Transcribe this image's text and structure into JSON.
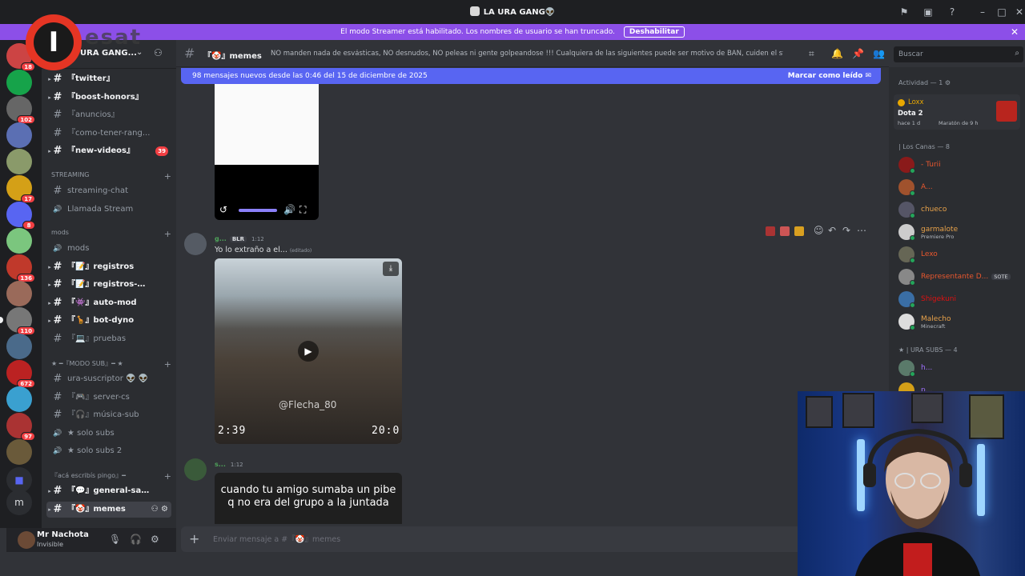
{
  "window": {
    "title": "LA URA GANG👽"
  },
  "banner": {
    "text": "El modo Streamer está habilitado. Los nombres de usuario se han truncado.",
    "button": "Deshabilitar"
  },
  "brand": {
    "text": "esat"
  },
  "rail": {
    "servers": [
      {
        "badge": "18",
        "color": "#c44"
      },
      {
        "badge": "",
        "color": "#16a34a"
      },
      {
        "badge": "102",
        "color": "#666"
      },
      {
        "badge": "",
        "color": "#5b6fb3"
      },
      {
        "badge": "",
        "color": "#8a9a6a"
      },
      {
        "badge": "17",
        "color": "#d4a017"
      },
      {
        "badge": "8",
        "color": "#5865f2"
      },
      {
        "badge": "",
        "color": "#7bc67e"
      },
      {
        "badge": "136",
        "color": "#c0392b"
      },
      {
        "badge": "",
        "color": "#9a6a5a"
      },
      {
        "badge": "110",
        "color": "#777"
      },
      {
        "badge": "",
        "color": "#4a6a8a"
      },
      {
        "badge": "672",
        "color": "#b22"
      },
      {
        "badge": "",
        "color": "#3aa0d0"
      },
      {
        "badge": "97",
        "color": "#a33"
      },
      {
        "badge": "",
        "color": "#6a5a3a"
      }
    ],
    "dm_letter": "m"
  },
  "sidebar": {
    "server_name": "URA GANG...",
    "channels_top": [
      {
        "label": "『twitter』",
        "bright": true,
        "badge": ""
      },
      {
        "label": "『boost-honors』",
        "bright": true,
        "badge": ""
      },
      {
        "label": "『anuncios』",
        "bright": false,
        "badge": ""
      },
      {
        "label": "『como-tener-rang...",
        "bright": false,
        "badge": ""
      },
      {
        "label": "『new-videos』",
        "bright": true,
        "badge": "39"
      }
    ],
    "cat_streaming": "STREAMING",
    "streaming": [
      {
        "label": "streaming-chat",
        "voice": false
      },
      {
        "label": "Llamada Stream",
        "voice": true
      }
    ],
    "cat_mods": "mods",
    "mods": [
      {
        "label": "mods",
        "voice": true,
        "bright": false
      },
      {
        "label": "『📝』registros",
        "voice": false,
        "bright": true
      },
      {
        "label": "『📝』registros-miem...",
        "voice": false,
        "bright": true
      },
      {
        "label": "『👾』auto-mod",
        "voice": false,
        "bright": true
      },
      {
        "label": "『🦒』bot-dyno",
        "voice": false,
        "bright": true
      },
      {
        "label": "『💻』pruebas",
        "voice": false,
        "bright": false
      }
    ],
    "cat_subs": "★ ━『MODO SUB』━ ★",
    "subs": [
      {
        "label": "ura-suscriptor 👽 👽",
        "voice": false
      },
      {
        "label": "『🎮』server-cs",
        "voice": false
      },
      {
        "label": "『🎧』música-sub",
        "voice": false
      },
      {
        "label": "★ solo subs",
        "voice": true
      },
      {
        "label": "★ solo subs 2",
        "voice": true
      }
    ],
    "cat_general": "『acá escribís pingo』━",
    "general": [
      {
        "label": "『💬』general-sape",
        "bright": true,
        "active": false
      },
      {
        "label": "『🤡』memes",
        "bright": true,
        "active": true
      }
    ]
  },
  "user": {
    "name": "Mr Nachota",
    "status": "Invisible"
  },
  "channel": {
    "name": "『🤡』memes",
    "topic": "NO manden nada de esvásticas, NO desnudos, NO peleas ni gente golpeandose !!! Cualquiera de las siguientes puede ser motivo de BAN, cuiden el stream!"
  },
  "search": {
    "placeholder": "Buscar"
  },
  "newbar": {
    "text": "98 mensajes nuevos desde las 0:46 del 15 de diciembre de 2025",
    "action": "Marcar como leído"
  },
  "messages": [
    {
      "author": "g...",
      "tag": "BLR",
      "time": "1:12",
      "text": "Yo lo extraño a el...",
      "edited": "(editado)",
      "video": {
        "watermark": "@Flecha_80",
        "time_left": "2:39",
        "time_right": "20:0"
      }
    },
    {
      "author": "s...",
      "time": "1:12",
      "caption_l1": "cuando tu amigo sumaba un pibe",
      "caption_l2": "q no era del grupo a la juntada"
    }
  ],
  "composer": {
    "placeholder": "Enviar mensaje a #『🤡』memes"
  },
  "members": {
    "activity_head": "Actividad — 1",
    "activity": {
      "name": "Loxx",
      "game": "Dota 2",
      "meta1": "hace 1 d",
      "meta2": "Maratón de 9 h"
    },
    "group1_head": "| Los Canas — 8",
    "group1": [
      {
        "name": "- Turii",
        "color": "#e8572e",
        "act": "",
        "tag": "",
        "av": "#8a1a1a"
      },
      {
        "name": "A...",
        "color": "#e8572e",
        "act": "",
        "tag": "",
        "av": "#a0522d"
      },
      {
        "name": "chueco",
        "color": "#e8a24a",
        "act": "",
        "tag": "",
        "av": "#556"
      },
      {
        "name": "garmalote",
        "color": "#e8a24a",
        "act": "Premiere Pro",
        "tag": "",
        "av": "#ccc"
      },
      {
        "name": "Lexo",
        "color": "#e8572e",
        "act": "",
        "tag": "",
        "av": "#665"
      },
      {
        "name": "Representante D...",
        "color": "#e8572e",
        "act": "",
        "tag": "SOTE",
        "av": "#888"
      },
      {
        "name": "Shigekuni",
        "color": "#d11",
        "act": "",
        "tag": "",
        "av": "#3a6ea5"
      },
      {
        "name": "Malecho",
        "color": "#e8a24a",
        "act": "Minecraft",
        "tag": "",
        "av": "#ddd"
      }
    ],
    "group2_head": "★ | URA SUBS — 4",
    "group2": [
      {
        "name": "h...",
        "color": "#a070ff",
        "act": "",
        "tag": "",
        "av": "#5a7a6a"
      },
      {
        "name": "p...",
        "color": "#a070ff",
        "act": "",
        "tag": "",
        "av": "#d4a017"
      }
    ]
  }
}
